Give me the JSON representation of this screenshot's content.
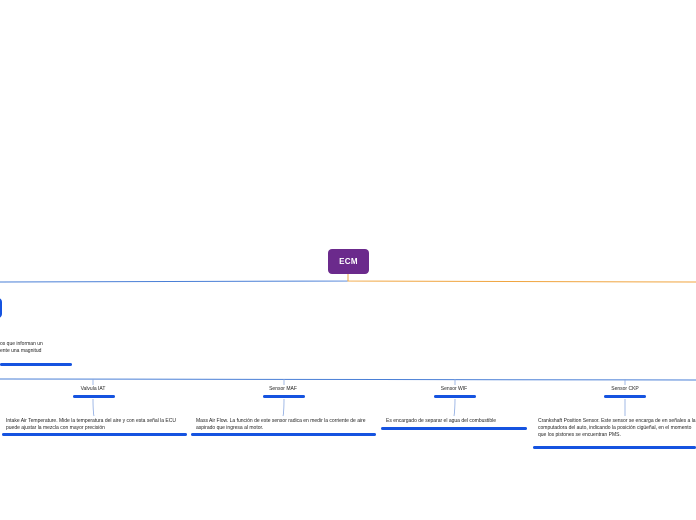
{
  "root": {
    "label": "ECM",
    "color": "#6b2a8c"
  },
  "colors": {
    "left_branch": "#4a7fd6",
    "right_branch": "#f0a540",
    "topic_bar": "#1553e0",
    "connector": "#8aa8e0"
  },
  "left_description": {
    "line1": "os que informan un",
    "line2": "ente una magnitud"
  },
  "sensors": [
    {
      "title": "Valvula IAT",
      "description": "Intake Air Temperature. Mide la temperatura del aire y con esta señal la ECU puede ajustar la mezcla con mayor precisión"
    },
    {
      "title": "Sensor MAF",
      "description": "Mass Air Flow. La función de este sensor radica en medir la corriente de aire aspirado que ingresa al motor."
    },
    {
      "title": "Sensor WIF",
      "description": "Es encargado de separar el agua del combustible"
    },
    {
      "title": "Sensor CKP",
      "description": "Crankshaft Position Sensor. Este sensor se encarga de en señales a la computadora del auto, indicando la posición cigüeñal, en el momento que los pistones se encuentran PMS."
    }
  ]
}
